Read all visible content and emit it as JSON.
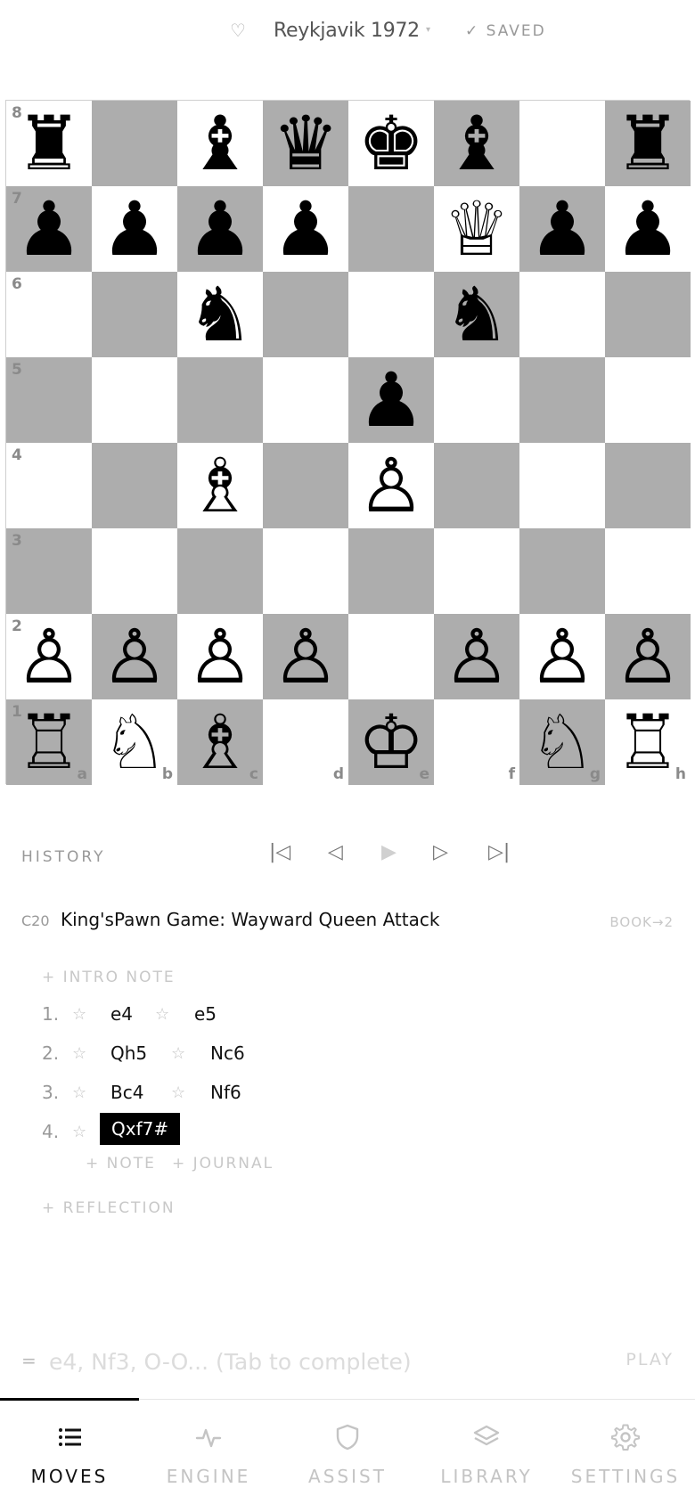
{
  "header": {
    "favorite_icon": "♡",
    "title": "Reykjavik 1972",
    "caret": "▾",
    "saved_status": "✓ SAVED"
  },
  "board": {
    "light_color": "#ffffff",
    "dark_color": "#adadad",
    "rank_labels": [
      "8",
      "7",
      "6",
      "5",
      "4",
      "3",
      "2",
      "1"
    ],
    "file_labels": [
      "a",
      "b",
      "c",
      "d",
      "e",
      "f",
      "g",
      "h"
    ],
    "rows": [
      [
        "♜",
        "",
        "♝",
        "♛",
        "♚",
        "♝",
        "",
        "♜"
      ],
      [
        "♟",
        "♟",
        "♟",
        "♟",
        "",
        "♕",
        "♟",
        "♟"
      ],
      [
        "",
        "",
        "♞",
        "",
        "",
        "♞",
        "",
        ""
      ],
      [
        "",
        "",
        "",
        "",
        "♟",
        "",
        "",
        ""
      ],
      [
        "",
        "",
        "♗",
        "",
        "♙",
        "",
        "",
        ""
      ],
      [
        "",
        "",
        "",
        "",
        "",
        "",
        "",
        ""
      ],
      [
        "♙",
        "♙",
        "♙",
        "♙",
        "",
        "♙",
        "♙",
        "♙"
      ],
      [
        "♖",
        "♘",
        "♗",
        "",
        "♔",
        "",
        "♘",
        "♖"
      ]
    ]
  },
  "history": {
    "label": "HISTORY",
    "nav": {
      "first": "|◁",
      "prev": "◁",
      "play": "▶",
      "next": "▷",
      "last": "▷|"
    }
  },
  "opening": {
    "eco": "C20",
    "name": "King'sPawn Game: Wayward Queen Attack",
    "book": "BOOK→2"
  },
  "moves": {
    "intro_note": "+ INTRO NOTE",
    "star": "☆",
    "list": [
      {
        "num": "1.",
        "white": "e4",
        "black": "e5"
      },
      {
        "num": "2.",
        "white": "Qh5",
        "black": "Nc6"
      },
      {
        "num": "3.",
        "white": "Bc4",
        "black": "Nf6"
      },
      {
        "num": "4.",
        "white": "Qxf7#",
        "black": ""
      }
    ],
    "add_note": "+ NOTE",
    "add_journal": "+ JOURNAL",
    "reflection": "+ REFLECTION"
  },
  "input": {
    "prefix": "=",
    "placeholder": "e4, Nf3, O-O... (Tab to complete)",
    "value": "",
    "play_label": "PLAY"
  },
  "tabs": [
    {
      "label": "MOVES",
      "icon": "list-icon",
      "active": true
    },
    {
      "label": "ENGINE",
      "icon": "pulse-icon",
      "active": false
    },
    {
      "label": "ASSIST",
      "icon": "shield-icon",
      "active": false
    },
    {
      "label": "LIBRARY",
      "icon": "layers-icon",
      "active": false
    },
    {
      "label": "SETTINGS",
      "icon": "gear-icon",
      "active": false
    }
  ]
}
